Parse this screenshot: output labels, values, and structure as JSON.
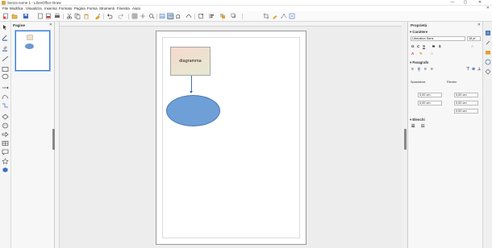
{
  "window": {
    "title": "Senza nome 1 - LibreOffice Draw",
    "minimize": "—",
    "maximize": "▢",
    "close": "✕"
  },
  "menu": {
    "items": [
      "File",
      "Modifica",
      "Visualizza",
      "Inserisci",
      "Formato",
      "Pagina",
      "Forma",
      "Strumenti",
      "Finestra",
      "Aiuto"
    ],
    "close_doc": "✕"
  },
  "pages_pane": {
    "title": "Pagine",
    "close": "✕"
  },
  "canvas": {
    "rect_text": "diagramma",
    "colors": {
      "rect_fill": "#f6d9cc",
      "oval_fill": "#6f9fd7",
      "connector": "#3d6fb5"
    }
  },
  "properties": {
    "title": "Proprietà",
    "close": "✕",
    "character_section": "Carattere",
    "font_name": "Liberation Sans",
    "font_size": "18 pt",
    "paragraph_section": "Paragrafo",
    "spacing_label": "Spaziatura",
    "indent_label": "Rientro",
    "spacing_above": "0,00 cm",
    "spacing_below": "0,00 cm",
    "indent_before": "0,00 cm",
    "indent_after": "0,00 cm",
    "indent_first": "0,00 cm",
    "lists_section": "Elenchi",
    "char_buttons": [
      "G",
      "C",
      "S",
      "S",
      "$"
    ]
  },
  "toolbar_icons": [
    "new-icon",
    "open-icon",
    "save-icon",
    "export-icon",
    "export-pdf-icon",
    "print-icon",
    "cut-icon",
    "copy-icon",
    "paste-icon",
    "clone-icon",
    "undo-icon",
    "redo-icon",
    "grid-icon",
    "helplines-icon",
    "zoom-icon",
    "image-icon",
    "table-icon",
    "special-char-icon",
    "fontwork-icon",
    "transform-icon",
    "align-icon",
    "arrange-icon",
    "shadow-icon",
    "crop-icon",
    "filter-icon",
    "points-icon",
    "glue-icon",
    "toggle-extrusion-icon"
  ]
}
